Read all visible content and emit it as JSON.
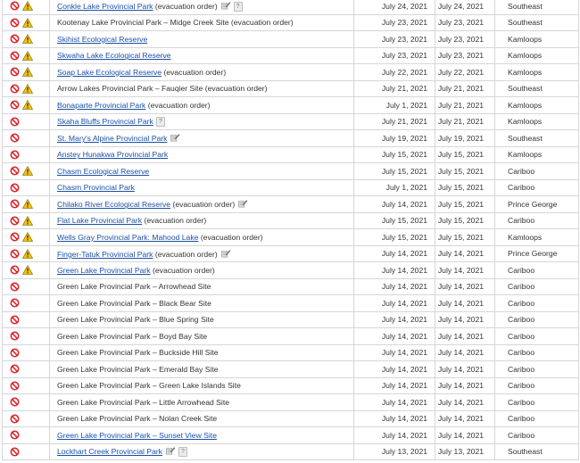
{
  "rows": [
    {
      "name": "Conkle Lake Provincial Park",
      "link": true,
      "note": "(evacuation order)",
      "ban": true,
      "warn": true,
      "pencil": true,
      "info": true,
      "date1": "July 24, 2021",
      "date2": "July 24, 2021",
      "region": "Southeast"
    },
    {
      "name": "Kootenay Lake Provincial Park – Midge Creek Site",
      "link": false,
      "note": "(evacuation order)",
      "ban": true,
      "warn": true,
      "pencil": false,
      "info": false,
      "date1": "July 23, 2021",
      "date2": "July 23, 2021",
      "region": "Southeast"
    },
    {
      "name": "Skihist Ecological Reserve",
      "link": true,
      "note": "",
      "ban": true,
      "warn": true,
      "pencil": false,
      "info": false,
      "date1": "July 23, 2021",
      "date2": "July 23, 2021",
      "region": "Kamloops"
    },
    {
      "name": "Skwaha Lake Ecological Reserve",
      "link": true,
      "note": "",
      "ban": true,
      "warn": true,
      "pencil": false,
      "info": false,
      "date1": "July 23, 2021",
      "date2": "July 23, 2021",
      "region": "Kamloops"
    },
    {
      "name": "Soap Lake Ecological Reserve",
      "link": true,
      "note": "(evacuation order)",
      "ban": true,
      "warn": true,
      "pencil": false,
      "info": false,
      "date1": "July 22, 2021",
      "date2": "July 22, 2021",
      "region": "Kamloops"
    },
    {
      "name": "Arrow Lakes Provincial Park – Fauqier Site",
      "link": false,
      "note": "(evacuation order)",
      "ban": true,
      "warn": true,
      "pencil": false,
      "info": false,
      "date1": "July 21, 2021",
      "date2": "July 21, 2021",
      "region": "Southeast"
    },
    {
      "name": "Bonaparte Provincial Park",
      "link": true,
      "note": "(evacuation order)",
      "ban": true,
      "warn": true,
      "pencil": false,
      "info": false,
      "date1": "July 1, 2021",
      "date2": "July 21, 2021",
      "region": "Kamloops"
    },
    {
      "name": "Skaha Bluffs Provincial Park",
      "link": true,
      "note": "",
      "ban": true,
      "warn": false,
      "pencil": false,
      "info": true,
      "date1": "July 21, 2021",
      "date2": "July 21, 2021",
      "region": "Kamloops"
    },
    {
      "name": "St. Mary's Alpine Provincial Park",
      "link": true,
      "note": "",
      "ban": true,
      "warn": false,
      "pencil": true,
      "info": false,
      "date1": "July 19, 2021",
      "date2": "July 19, 2021",
      "region": "Southeast"
    },
    {
      "name": "Anstey Hunakwa Provincial Park",
      "link": true,
      "note": "",
      "ban": true,
      "warn": false,
      "pencil": false,
      "info": false,
      "date1": "July 15, 2021",
      "date2": "July 15, 2021",
      "region": "Kamloops"
    },
    {
      "name": "Chasm Ecological Reserve",
      "link": true,
      "note": "",
      "ban": true,
      "warn": true,
      "pencil": false,
      "info": false,
      "date1": "July 15, 2021",
      "date2": "July 15, 2021",
      "region": "Cariboo"
    },
    {
      "name": "Chasm Provincial Park",
      "link": true,
      "note": "",
      "ban": true,
      "warn": false,
      "pencil": false,
      "info": false,
      "date1": "July 1, 2021",
      "date2": "July 15, 2021",
      "region": "Cariboo"
    },
    {
      "name": "Chilako River Ecological Reserve",
      "link": true,
      "note": "(evacuation order)",
      "ban": true,
      "warn": true,
      "pencil": true,
      "info": false,
      "date1": "July 14, 2021",
      "date2": "July 15, 2021",
      "region": "Prince George"
    },
    {
      "name": "Flat Lake Provincial Park",
      "link": true,
      "note": "(evacuation order)",
      "ban": true,
      "warn": true,
      "pencil": false,
      "info": false,
      "date1": "July 15, 2021",
      "date2": "July 15, 2021",
      "region": "Cariboo"
    },
    {
      "name": "Wells Gray Provincial Park: Mahood Lake",
      "link": true,
      "note": "(evacuation order)",
      "ban": true,
      "warn": true,
      "pencil": false,
      "info": false,
      "date1": "July 15, 2021",
      "date2": "July 15, 2021",
      "region": "Kamloops"
    },
    {
      "name": "Finger-Tatuk Provincial Park",
      "link": true,
      "note": "(evacuation order)",
      "ban": true,
      "warn": true,
      "pencil": true,
      "info": false,
      "date1": "July 14, 2021",
      "date2": "July 14, 2021",
      "region": "Prince George"
    },
    {
      "name": "Green Lake Provincial Park",
      "link": true,
      "note": "(evacuation order)",
      "ban": true,
      "warn": true,
      "pencil": false,
      "info": false,
      "date1": "July 14, 2021",
      "date2": "July 14, 2021",
      "region": "Cariboo"
    },
    {
      "name": "Green Lake Provincial Park – Arrowhead Site",
      "link": false,
      "note": "",
      "ban": true,
      "warn": false,
      "pencil": false,
      "info": false,
      "date1": "July 14, 2021",
      "date2": "July 14, 2021",
      "region": "Cariboo"
    },
    {
      "name": "Green Lake Provincial Park – Black Bear Site",
      "link": false,
      "note": "",
      "ban": true,
      "warn": false,
      "pencil": false,
      "info": false,
      "date1": "July 14, 2021",
      "date2": "July 14, 2021",
      "region": "Cariboo"
    },
    {
      "name": "Green Lake Provincial Park – Blue Spring Site",
      "link": false,
      "note": "",
      "ban": true,
      "warn": false,
      "pencil": false,
      "info": false,
      "date1": "July 14, 2021",
      "date2": "July 14, 2021",
      "region": "Cariboo"
    },
    {
      "name": "Green Lake Provincial Park – Boyd Bay Site",
      "link": false,
      "note": "",
      "ban": true,
      "warn": false,
      "pencil": false,
      "info": false,
      "date1": "July 14, 2021",
      "date2": "July 14, 2021",
      "region": "Cariboo"
    },
    {
      "name": "Green Lake Provincial Park – Buckside Hill Site",
      "link": false,
      "note": "",
      "ban": true,
      "warn": false,
      "pencil": false,
      "info": false,
      "date1": "July 14, 2021",
      "date2": "July 14, 2021",
      "region": "Cariboo"
    },
    {
      "name": "Green Lake Provincial Park – Emerald Bay Site",
      "link": false,
      "note": "",
      "ban": true,
      "warn": false,
      "pencil": false,
      "info": false,
      "date1": "July 14, 2021",
      "date2": "July 14, 2021",
      "region": "Cariboo"
    },
    {
      "name": "Green Lake Provincial Park – Green Lake Islands Site",
      "link": false,
      "note": "",
      "ban": true,
      "warn": false,
      "pencil": false,
      "info": false,
      "date1": "July 14, 2021",
      "date2": "July 14, 2021",
      "region": "Cariboo"
    },
    {
      "name": "Green Lake Provincial Park – Little Arrowhead Site",
      "link": false,
      "note": "",
      "ban": true,
      "warn": false,
      "pencil": false,
      "info": false,
      "date1": "July 14, 2021",
      "date2": "July 14, 2021",
      "region": "Cariboo"
    },
    {
      "name": "Green Lake Provincial Park – Nolan Creek Site",
      "link": false,
      "note": "",
      "ban": true,
      "warn": false,
      "pencil": false,
      "info": false,
      "date1": "July 14, 2021",
      "date2": "July 14, 2021",
      "region": "Cariboo"
    },
    {
      "name": "Green Lake Provincial Park – Sunset View Site",
      "link": true,
      "note": "",
      "ban": true,
      "warn": false,
      "pencil": false,
      "info": false,
      "date1": "July 14, 2021",
      "date2": "July 14, 2021",
      "region": "Cariboo"
    },
    {
      "name": "Lockhart Creek Provincial Park",
      "link": true,
      "note": "",
      "ban": true,
      "warn": false,
      "pencil": true,
      "info": true,
      "date1": "July 13, 2021",
      "date2": "July 13, 2021",
      "region": "Southeast"
    }
  ],
  "icons": {
    "closure": "no-entry-icon",
    "warning": "warning-icon",
    "note": "pencil-note-icon",
    "info": "info-icon",
    "closure_color": "#d8262c",
    "warning_color": "#f4c400",
    "link_color": "#1a4fa8"
  },
  "info_glyph": "?"
}
